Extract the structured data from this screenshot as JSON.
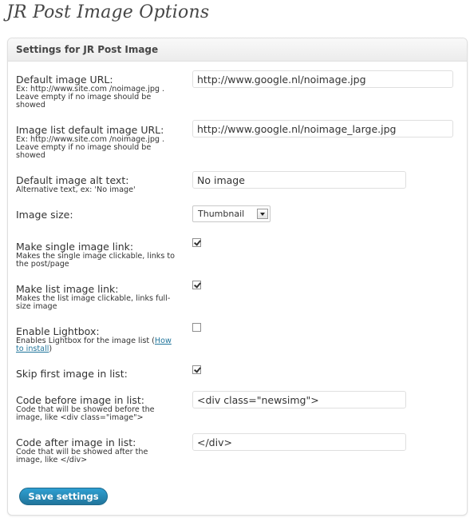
{
  "page": {
    "title": "JR Post Image Options"
  },
  "panel": {
    "heading": "Settings for JR Post Image"
  },
  "rows": {
    "default_image_url": {
      "label": "Default image URL:",
      "desc": "Ex: http://www.site.com /noimage.jpg . Leave empty if no image should be showed",
      "value": "http://www.google.nl/noimage.jpg"
    },
    "list_default_image_url": {
      "label": "Image list default image URL:",
      "desc": "Ex: http://www.site.com /noimage.jpg . Leave empty if no image should be showed",
      "value": "http://www.google.nl/noimage_large.jpg"
    },
    "alt_text": {
      "label": "Default image alt text:",
      "desc": "Alternative text, ex: 'No image'",
      "value": "No image"
    },
    "image_size": {
      "label": "Image size:",
      "value": "Thumbnail"
    },
    "single_image_link": {
      "label": "Make single image link:",
      "desc": "Makes the single image clickable, links to the post/page",
      "checked": true
    },
    "list_image_link": {
      "label": "Make list image link:",
      "desc": "Makes the list image clickable, links full-size image",
      "checked": true
    },
    "lightbox": {
      "label": "Enable Lightbox:",
      "desc_prefix": "Enables Lightbox for the image list (",
      "desc_link": "How to install",
      "desc_suffix": ")",
      "checked": false
    },
    "skip_first": {
      "label": "Skip first image in list:",
      "checked": true
    },
    "code_before": {
      "label": "Code before image in list:",
      "desc": "Code that will be showed before the image, like <div class=\"image\">",
      "value": "<div class=\"newsimg\">"
    },
    "code_after": {
      "label": "Code after image in list:",
      "desc": "Code that will be showed after the image, like </div>",
      "value": "</div>"
    }
  },
  "save_button": {
    "label": "Save settings"
  }
}
